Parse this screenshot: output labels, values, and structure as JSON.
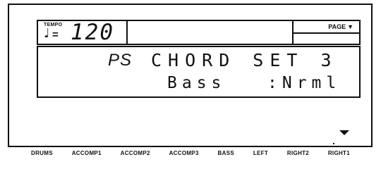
{
  "tempo": {
    "label": "TEMPO",
    "note_glyph": "♩",
    "equals": "=",
    "value": "120"
  },
  "page": {
    "label": "PAGE",
    "arrow": "▼"
  },
  "main": {
    "prefix": "PS",
    "title": "CHORD SET 3",
    "param_name": "Bass",
    "param_value": ":Nrml"
  },
  "buttons": [
    "DRUMS",
    "ACCOMP1",
    "ACCOMP2",
    "ACCOMP3",
    "BASS",
    "LEFT",
    "RIGHT2",
    "RIGHT1"
  ]
}
